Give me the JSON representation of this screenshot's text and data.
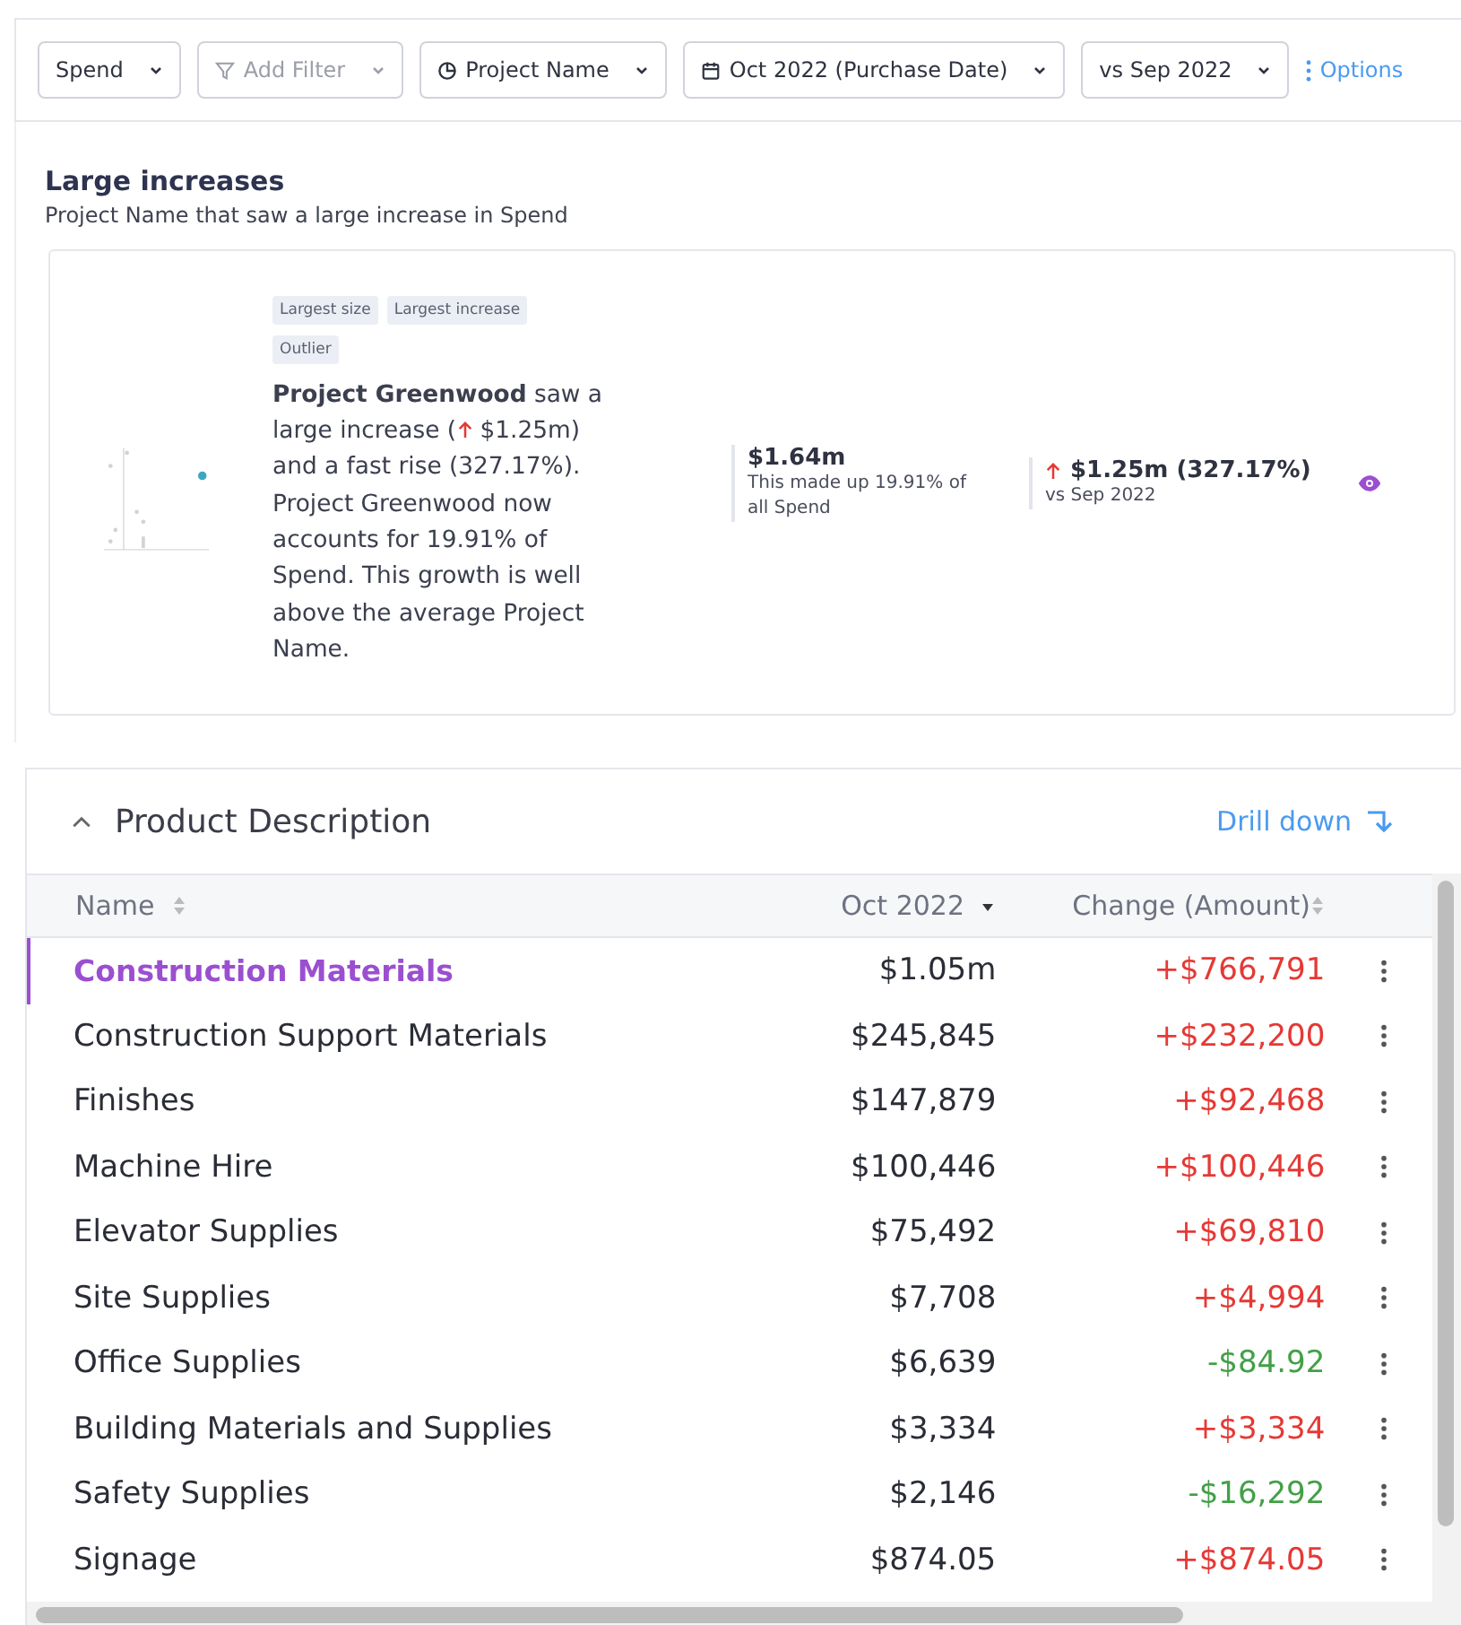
{
  "filters": [
    {
      "kind": "plain",
      "label": "Spend",
      "muted": false
    },
    {
      "kind": "filter",
      "label": "Add Filter",
      "muted": true
    },
    {
      "kind": "group",
      "label": "Project Name",
      "muted": false
    },
    {
      "kind": "calendar",
      "label": "Oct 2022 (Purchase Date)",
      "muted": false
    },
    {
      "kind": "plain",
      "label": "vs Sep 2022",
      "muted": false
    }
  ],
  "options_label": "Options",
  "insight": {
    "title": "Large increases",
    "subtitle": "Project Name that saw a large increase in Spend",
    "tags": [
      "Largest size",
      "Largest increase",
      "Outlier"
    ],
    "summary": "**Project Greenwood** saw a large increase (",
    "summary_amount": "$1.25m)",
    "summary_rest": "and a fast rise (327.17%). Project Greenwood now accounts for 19.91% of Spend. This growth is well above the average Project Name.",
    "total": "$1.64m",
    "total_note": "This made up 19.91% of all Spend",
    "change": "$1.25m (327.17%)",
    "change_note": "vs Sep 2022"
  },
  "table": {
    "title": "Product Description",
    "expanded": true,
    "drill_label": "Drill down",
    "columns": [
      {
        "label": "Name",
        "sorted": false
      },
      {
        "label": "Oct 2022",
        "sorted": true
      },
      {
        "label": "Change (Amount)",
        "sorted": false
      }
    ],
    "rows": [
      {
        "name": "Construction Materials",
        "value": "$1.05m",
        "change": "+$766,791",
        "kind": "increase",
        "selected": true
      },
      {
        "name": "Construction Support Materials",
        "value": "$245,845",
        "change": "+$232,200",
        "kind": "increase",
        "selected": false
      },
      {
        "name": "Finishes",
        "value": "$147,879",
        "change": "+$92,468",
        "kind": "increase",
        "selected": false
      },
      {
        "name": "Machine Hire",
        "value": "$100,446",
        "change": "+$100,446",
        "kind": "increase",
        "selected": false
      },
      {
        "name": "Elevator Supplies",
        "value": "$75,492",
        "change": "+$69,810",
        "kind": "increase",
        "selected": false
      },
      {
        "name": "Site Supplies",
        "value": "$7,708",
        "change": "+$4,994",
        "kind": "increase",
        "selected": false
      },
      {
        "name": "Office Supplies",
        "value": "$6,639",
        "change": "-$84.92",
        "kind": "decrease",
        "selected": false
      },
      {
        "name": "Building Materials and Supplies",
        "value": "$3,334",
        "change": "+$3,334",
        "kind": "increase",
        "selected": false
      },
      {
        "name": "Safety Supplies",
        "value": "$2,146",
        "change": "-$16,292",
        "kind": "decrease",
        "selected": false
      },
      {
        "name": "Signage",
        "value": "$874.05",
        "change": "+$874.05",
        "kind": "increase",
        "selected": false
      }
    ]
  }
}
